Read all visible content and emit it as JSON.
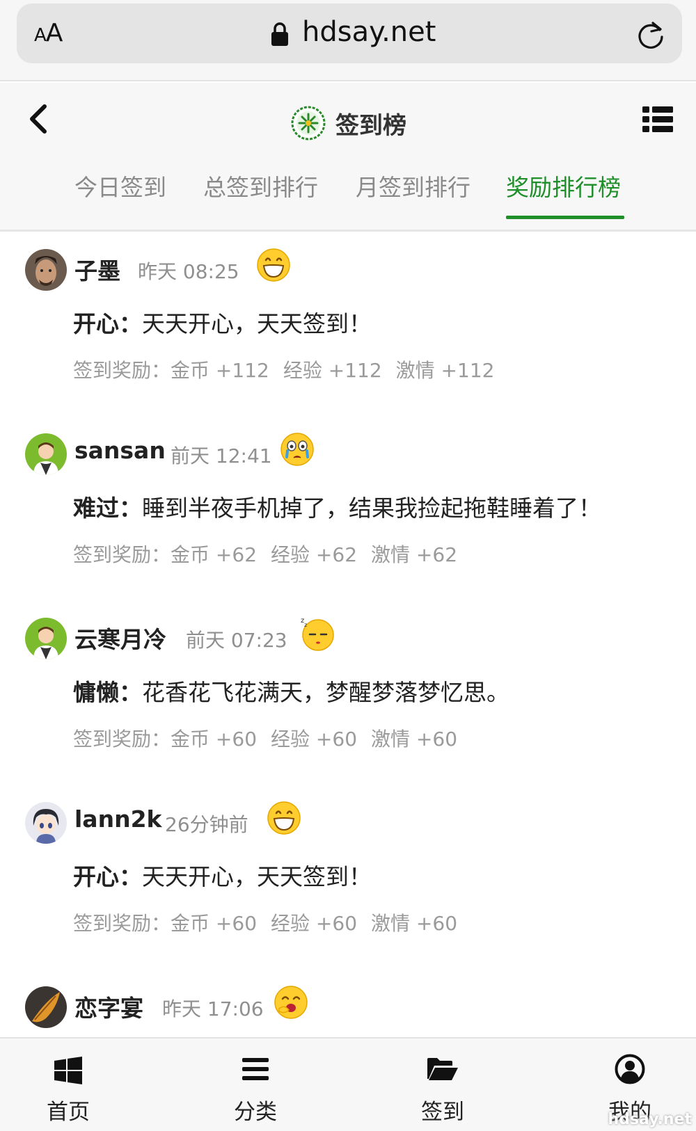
{
  "browser": {
    "text_size_label": "AA",
    "domain": "hdsay.net"
  },
  "header": {
    "title": "签到榜",
    "tabs": [
      {
        "label": "今日签到",
        "active": false
      },
      {
        "label": "总签到排行",
        "active": false
      },
      {
        "label": "月签到排行",
        "active": false
      },
      {
        "label": "奖励排行榜",
        "active": true
      }
    ]
  },
  "entries": [
    {
      "username": "子墨",
      "time": "昨天 08:25",
      "emoji": "grin-emoji",
      "mood": "开心：",
      "message": "天天开心，天天签到！",
      "reward_label": "签到奖励：",
      "coins": "金币 +112",
      "exp": "经验 +112",
      "passion": "激情 +112"
    },
    {
      "username": "sansan",
      "time": "前天 12:41",
      "emoji": "crying-emoji",
      "mood": "难过：",
      "message": "睡到半夜手机掉了，结果我捡起拖鞋睡着了！",
      "reward_label": "签到奖励：",
      "coins": "金币 +62",
      "exp": "经验 +62",
      "passion": "激情 +62"
    },
    {
      "username": "云寒月冷",
      "time": "前天 07:23",
      "emoji": "sleepy-emoji",
      "mood": "慵懒：",
      "message": "花香花飞花满天，梦醒梦落梦忆思。",
      "reward_label": "签到奖励：",
      "coins": "金币 +60",
      "exp": "经验 +60",
      "passion": "激情 +60"
    },
    {
      "username": "lann2k",
      "time": "26分钟前",
      "emoji": "grin-emoji",
      "mood": "开心：",
      "message": "天天开心，天天签到！",
      "reward_label": "签到奖励：",
      "coins": "金币 +60",
      "exp": "经验 +60",
      "passion": "激情 +60"
    },
    {
      "username": "恋字宴",
      "time": "昨天 17:06",
      "emoji": "yawn-emoji"
    }
  ],
  "bottom_nav": [
    {
      "label": "首页",
      "icon": "windows-icon"
    },
    {
      "label": "分类",
      "icon": "list-icon"
    },
    {
      "label": "签到",
      "icon": "folder-open-icon"
    },
    {
      "label": "我的",
      "icon": "user-circle-icon"
    }
  ],
  "watermark": "hdsay.net",
  "colors": {
    "accent": "#1f8f2a",
    "muted_text": "#8f8f8f"
  }
}
